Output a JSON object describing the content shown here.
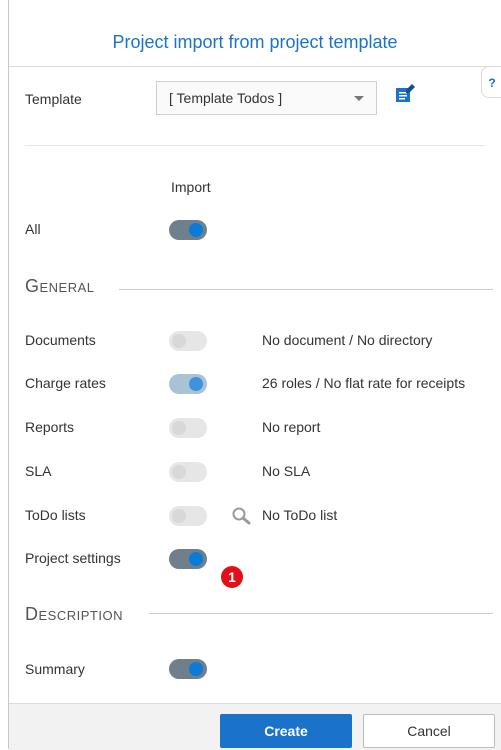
{
  "dialog": {
    "title": "Project import from project template",
    "help_label": "?"
  },
  "template": {
    "label": "Template",
    "selected": "[ Template Todos ]"
  },
  "column_header": "Import",
  "all": {
    "label": "All",
    "enabled": true
  },
  "sections": {
    "general": "General",
    "description": "Description"
  },
  "general_rows": [
    {
      "label": "Documents",
      "enabled": false,
      "info": "No document / No directory"
    },
    {
      "label": "Charge rates",
      "enabled": true,
      "info": "26 roles / No flat rate for receipts"
    },
    {
      "label": "Reports",
      "enabled": false,
      "info": "No report"
    },
    {
      "label": "SLA",
      "enabled": false,
      "info": "No SLA"
    },
    {
      "label": "ToDo lists",
      "enabled": false,
      "info": "No ToDo list"
    },
    {
      "label": "Project settings",
      "enabled": true,
      "info": ""
    }
  ],
  "badge": "1",
  "description_rows": [
    {
      "label": "Summary",
      "enabled": true
    }
  ],
  "buttons": {
    "create": "Create",
    "cancel": "Cancel"
  },
  "colors": {
    "accent": "#1a73c9",
    "toggle_knob_on": "#0a7bd6",
    "badge": "#e3101a"
  }
}
